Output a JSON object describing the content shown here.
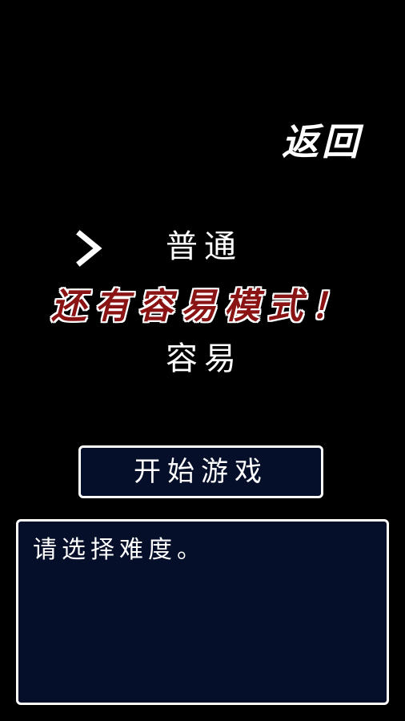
{
  "header": {
    "back_label": "返回"
  },
  "difficulty": {
    "options": [
      {
        "label": "普通",
        "selected": true
      },
      {
        "label": "容易",
        "selected": false
      }
    ],
    "selector_icon": "chevron-right-icon"
  },
  "banner": {
    "text": "还有容易模式！"
  },
  "start_button": {
    "label": "开始游戏"
  },
  "message": {
    "text": "请选择难度。"
  },
  "colors": {
    "background": "#000000",
    "panel": "#050f2a",
    "banner_fill": "#8a1414",
    "text": "#ffffff"
  }
}
